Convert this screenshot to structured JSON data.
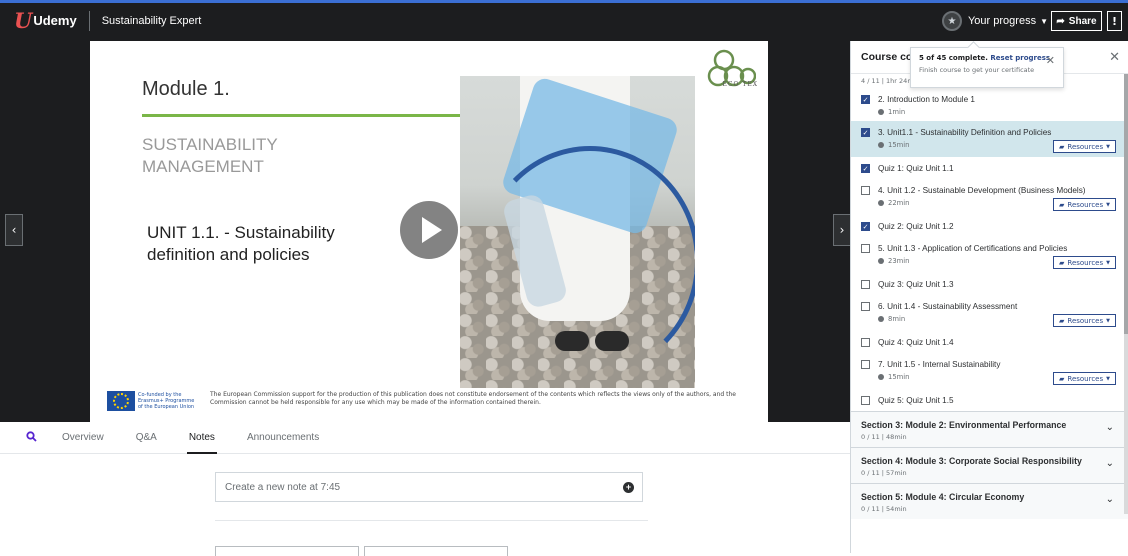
{
  "header": {
    "logo_text": "Udemy",
    "course_title": "Sustainability Expert",
    "progress_label": "Your progress",
    "share_label": "Share",
    "more_label": "!"
  },
  "slide": {
    "module": "Module 1.",
    "subtitle": "SUSTAINABILITY MANAGEMENT",
    "unit": "UNIT 1.1. - Sustainability definition and policies",
    "eco_brand": "ECO TEX",
    "eu_text": "Co-funded by the Erasmus+ Programme of the European Union",
    "disclaimer": "The European Commission support for the production of this publication does not constitute endorsement of the contents which reflects the views only of the authors, and the Commission cannot be held responsible for any use which may be made of the information contained therein."
  },
  "tabs": {
    "items": [
      "Overview",
      "Q&A",
      "Notes",
      "Announcements"
    ],
    "active": "Notes"
  },
  "notes": {
    "placeholder": "Create a new note at 7:45"
  },
  "tooltip": {
    "complete_text": "5 of 45 complete.",
    "reset_link": "Reset progress",
    "finish_text": "Finish course to get your certificate"
  },
  "sidebar": {
    "title": "Course content",
    "current_section_meta": "4 / 11 | 1hr 24min",
    "lectures": [
      {
        "title": "2. Introduction to Module 1",
        "duration": "1min",
        "checked": true,
        "resources": false,
        "active": false
      },
      {
        "title": "3. Unit1.1 - Sustainability Definition and Policies",
        "duration": "15min",
        "checked": true,
        "resources": true,
        "active": true
      },
      {
        "title": "Quiz 1: Quiz Unit 1.1",
        "duration": "",
        "checked": true,
        "resources": false,
        "active": false
      },
      {
        "title": "4. Unit 1.2 - Sustainable Development (Business Models)",
        "duration": "22min",
        "checked": false,
        "resources": true,
        "active": false
      },
      {
        "title": "Quiz 2: Quiz Unit 1.2",
        "duration": "",
        "checked": true,
        "resources": false,
        "active": false
      },
      {
        "title": "5. Unit 1.3 - Application of Certifications and Policies",
        "duration": "23min",
        "checked": false,
        "resources": true,
        "active": false
      },
      {
        "title": "Quiz 3: Quiz Unit 1.3",
        "duration": "",
        "checked": false,
        "resources": false,
        "active": false
      },
      {
        "title": "6. Unit 1.4 - Sustainability Assessment",
        "duration": "8min",
        "checked": false,
        "resources": true,
        "active": false
      },
      {
        "title": "Quiz 4: Quiz Unit 1.4",
        "duration": "",
        "checked": false,
        "resources": false,
        "active": false
      },
      {
        "title": "7. Unit 1.5 - Internal Sustainability",
        "duration": "15min",
        "checked": false,
        "resources": true,
        "active": false
      },
      {
        "title": "Quiz 5: Quiz Unit 1.5",
        "duration": "",
        "checked": false,
        "resources": false,
        "active": false
      }
    ],
    "resources_label": "Resources",
    "sections": [
      {
        "title": "Section 3: Module 2: Environmental Performance",
        "meta": "0 / 11 | 48min"
      },
      {
        "title": "Section 4: Module 3: Corporate Social Responsibility",
        "meta": "0 / 11 | 57min"
      },
      {
        "title": "Section 5: Module 4: Circular Economy",
        "meta": "0 / 11 | 54min"
      }
    ]
  },
  "colors": {
    "brand_red": "#ea5252",
    "accent_green": "#7ab648",
    "check_blue": "#2d4b8c",
    "active_row": "#d1e6ec"
  }
}
